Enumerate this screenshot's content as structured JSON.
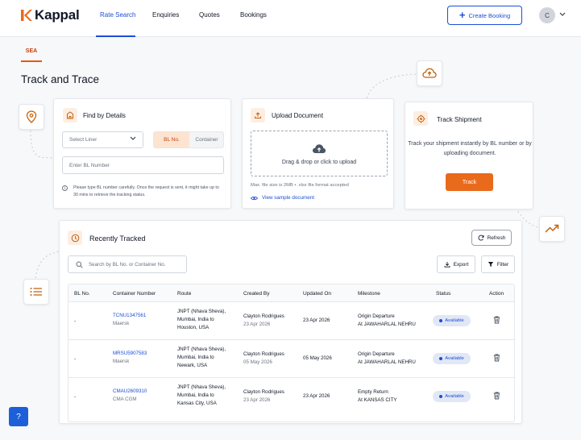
{
  "brand": {
    "name": "Kappal",
    "accent": "#ea6a1c",
    "primary": "#1d4ed8"
  },
  "nav": {
    "items": [
      {
        "label": "Rate Search",
        "active": true
      },
      {
        "label": "Enquiries",
        "active": false
      },
      {
        "label": "Quotes",
        "active": false
      },
      {
        "label": "Bookings",
        "active": false
      }
    ],
    "create_booking_label": "Create Booking",
    "avatar_initial": "C"
  },
  "mode_tab": "SEA",
  "page_title": "Track and Trace",
  "find_by_details": {
    "title": "Find by Details",
    "liner_placeholder": "Select Liner",
    "toggle": {
      "selected": "BL No.",
      "other": "Container"
    },
    "bl_placeholder": "Enter BL Number",
    "note": "Please type BL number carefully. Once the request is sent, it might take up to 30 mins to retrieve the tracking status."
  },
  "upload_document": {
    "title": "Upload Document",
    "drop_text": "Drag & drop or click to upload",
    "limits_text": "Max. file size is 2MB   •   .xlsx file format accepted",
    "sample_link": "View sample document"
  },
  "track_shipment": {
    "title": "Track Shipment",
    "description": "Track your shipment instantly by BL number or by uploading document.",
    "button_label": "Track"
  },
  "recently_tracked": {
    "title": "Recently Tracked",
    "refresh_label": "Refresh",
    "search_placeholder": "Search by BL No. or Container No.",
    "export_label": "Export",
    "filter_label": "Filter",
    "columns": [
      "BL No.",
      "Container Number",
      "Route",
      "Created By",
      "Updated On",
      "Milestone",
      "Status",
      "Action"
    ],
    "rows": [
      {
        "bl_no": "-",
        "container": "TCNU1347561",
        "liner": "Maersk",
        "route": [
          "JNPT (Nhava Sheva),",
          "Mumbai, India to",
          "Houston, USA"
        ],
        "created_by": "Clayton Rodrigues",
        "created_on": "23 Apr 2026",
        "updated_on": "23 Apr 2026",
        "milestone": [
          "Origin Departure",
          "At JAWAHARLAL NEHRU"
        ],
        "status": "Available"
      },
      {
        "bl_no": "-",
        "container": "MRSU5907583",
        "liner": "Maersk",
        "route": [
          "JNPT (Nhava Sheva),",
          "Mumbai, India to",
          "Newark, USA"
        ],
        "created_by": "Clayton Rodrigues",
        "created_on": "05 May 2026",
        "updated_on": "05 May 2026",
        "milestone": [
          "Origin Departure",
          "At JAWAHARLAL NEHRU"
        ],
        "status": "Available"
      },
      {
        "bl_no": "-",
        "container": "CMAU2609310",
        "liner": "CMA CGM",
        "route": [
          "JNPT (Nhava Sheva),",
          "Mumbai, India to",
          "Kansas City, USA"
        ],
        "created_by": "Clayton Rodrigues",
        "created_on": "23 Apr 2026",
        "updated_on": "23 Apr 2026",
        "milestone": [
          "Empty Return",
          "At KANSAS CITY"
        ],
        "status": "Available"
      }
    ]
  },
  "help_label": "?",
  "icons": [
    "location-pin-icon",
    "cloud-upload-icon",
    "trending-up-icon",
    "list-icon",
    "building-icon",
    "upload-icon",
    "target-icon",
    "clock-icon",
    "refresh-icon",
    "search-icon",
    "download-icon",
    "filter-icon",
    "eye-icon",
    "trash-icon",
    "info-icon",
    "chevron-down-icon",
    "plus-icon"
  ]
}
